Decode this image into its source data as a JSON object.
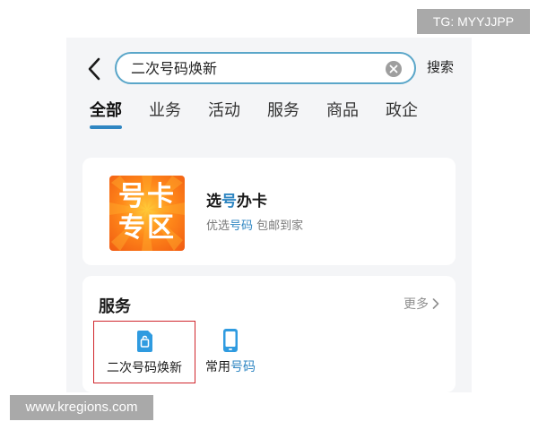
{
  "search": {
    "value": "二次号码焕新",
    "button_label": "搜索"
  },
  "tabs": [
    {
      "label": "全部",
      "active": true
    },
    {
      "label": "业务",
      "active": false
    },
    {
      "label": "活动",
      "active": false
    },
    {
      "label": "服务",
      "active": false
    },
    {
      "label": "商品",
      "active": false
    },
    {
      "label": "政企",
      "active": false
    }
  ],
  "promo_card": {
    "image_text_line1": "号卡",
    "image_text_line2": "专区",
    "title_part1": "选",
    "title_highlight": "号",
    "title_part2": "办卡",
    "subtitle_part1": "优选",
    "subtitle_highlight": "号码",
    "subtitle_part2": " 包邮到家"
  },
  "services": {
    "title": "服务",
    "more_label": "更多",
    "items": [
      {
        "label": "二次号码焕新",
        "icon": "sim-card-icon",
        "selected": true
      },
      {
        "label_part1": "常用",
        "label_highlight": "号码",
        "icon": "phone-icon",
        "selected": false
      }
    ]
  },
  "watermarks": {
    "top_right": "TG: MYYJJPP",
    "bottom_left": "www.kregions.com"
  },
  "colors": {
    "accent": "#2f86c2",
    "search_border": "#5aa6c9",
    "selection_outline": "#d0272d",
    "promo_orange": "#f15a12"
  }
}
